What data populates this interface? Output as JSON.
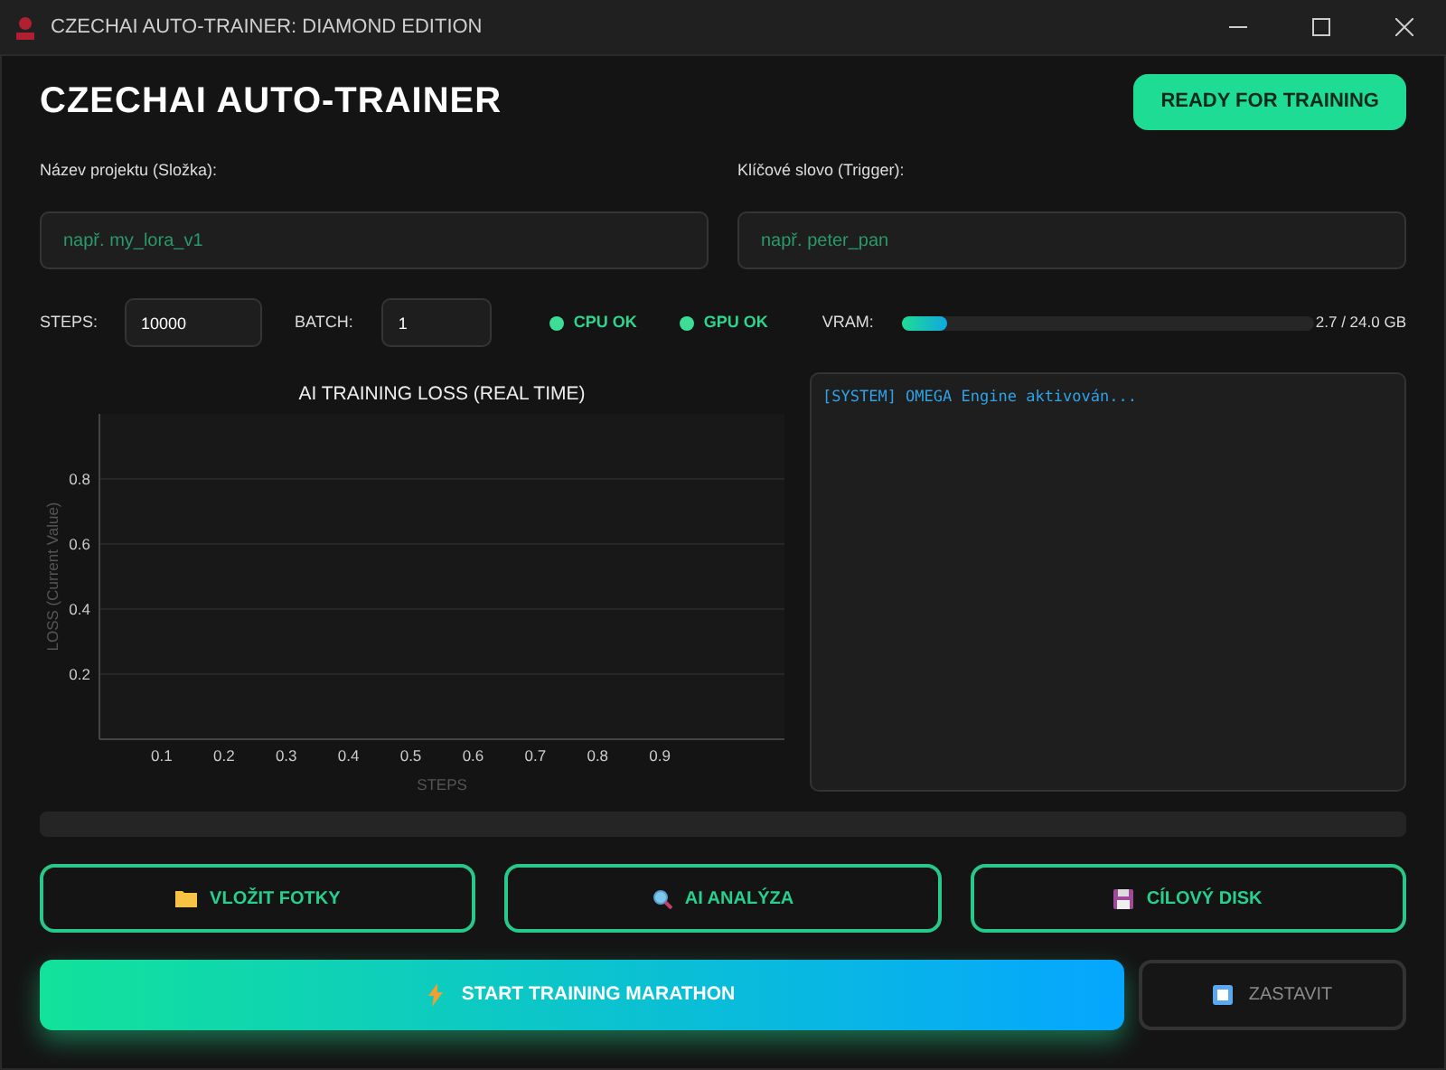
{
  "window": {
    "title": "CZECHAI AUTO-TRAINER: DIAMOND EDITION"
  },
  "header": {
    "title": "CZECHAI AUTO-TRAINER",
    "status_badge": "READY FOR TRAINING"
  },
  "fields": [
    {
      "label": "Název projektu (Složka):",
      "placeholder": "např. my_lora_v1"
    },
    {
      "label": "Klíčové slovo (Trigger):",
      "placeholder": "např. peter_pan"
    }
  ],
  "settings": [
    {
      "label": "STEPS:",
      "value": "10000"
    },
    {
      "label": "BATCH:",
      "value": "1"
    }
  ],
  "indicators": [
    {
      "label": "CPU OK",
      "color": "#3ddc97"
    },
    {
      "label": "GPU OK",
      "color": "#3ddc97"
    }
  ],
  "vram": {
    "label": "VRAM:",
    "level": 0.11,
    "reading": "2.7 / 24.0 GB"
  },
  "chart": {
    "chart_data": {
      "type": "line",
      "title": "AI TRAINING LOSS (REAL TIME)",
      "xlabel": "STEPS",
      "ylabel": "LOSS (Current Value)",
      "grid": true,
      "xlim": [
        0,
        1.1
      ],
      "ylim": [
        0,
        1
      ],
      "xticks": [
        0.1,
        0.2,
        0.3,
        0.4,
        0.5,
        0.6,
        0.7,
        0.8,
        0.9
      ],
      "yticks": [
        0.2,
        0.4,
        0.6,
        0.8
      ]
    }
  },
  "console": {
    "lines": [
      "[SYSTEM] OMEGA Engine aktivován..."
    ]
  },
  "actions": [
    {
      "label": "VLOŽIT FOTKY",
      "kind": "folder"
    },
    {
      "label": "AI ANALÝZA",
      "kind": "search"
    },
    {
      "label": "CÍLOVÝ DISK",
      "kind": "disk"
    }
  ],
  "start_button": {
    "label": "START TRAINING MARATHON"
  },
  "stop_button": {
    "label": "ZASTAVIT",
    "disabled": true
  }
}
